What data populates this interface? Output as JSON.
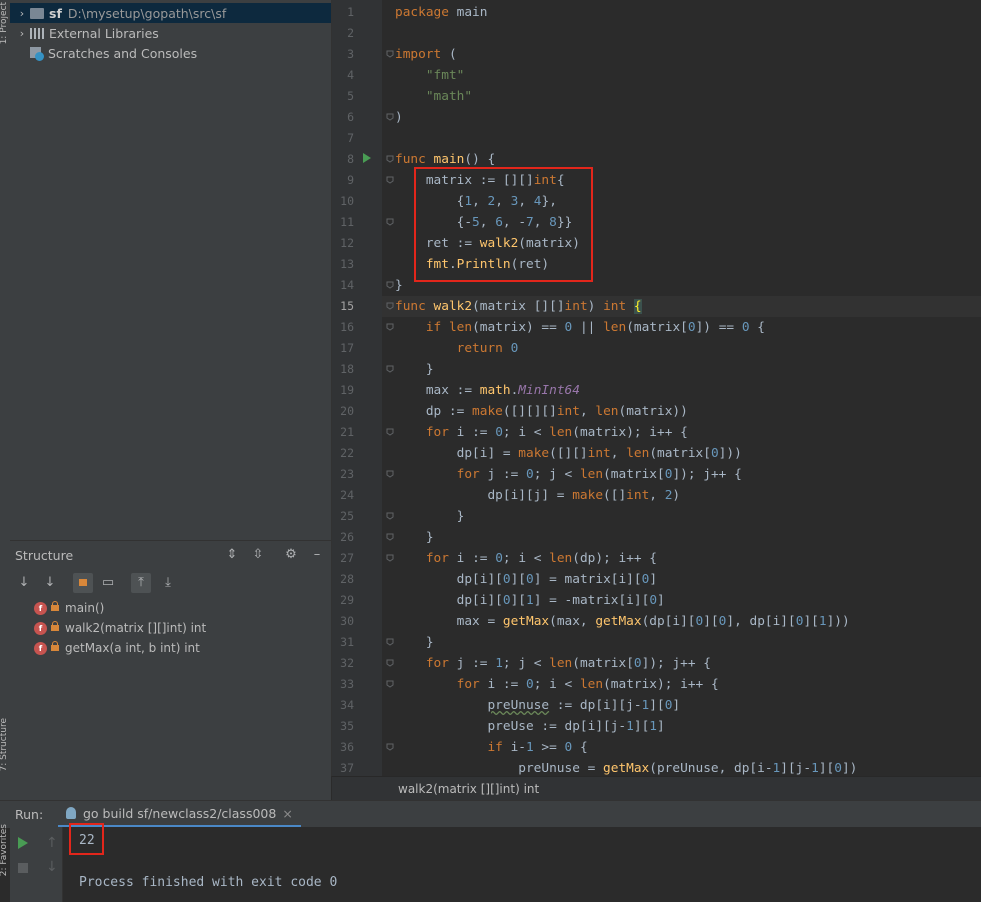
{
  "left_strip": {
    "top_label": "1: Project",
    "bottom_label": "7: Structure",
    "fav_label": "2: Favorites"
  },
  "project_tree": {
    "items": [
      {
        "name": "sf",
        "path": "D:\\mysetup\\gopath\\src\\sf"
      },
      {
        "name": "External Libraries"
      },
      {
        "name": "Scratches and Consoles"
      }
    ]
  },
  "structure": {
    "title": "Structure",
    "items": [
      {
        "badge": "f",
        "label": "main()"
      },
      {
        "badge": "f",
        "label": "walk2(matrix [][]int) int"
      },
      {
        "badge": "f",
        "label": "getMax(a int, b int) int"
      }
    ]
  },
  "editor": {
    "line_numbers": [
      "1",
      "2",
      "3",
      "4",
      "5",
      "6",
      "7",
      "8",
      "9",
      "10",
      "11",
      "12",
      "13",
      "14",
      "15",
      "16",
      "17",
      "18",
      "19",
      "20",
      "21",
      "22",
      "23",
      "24",
      "25",
      "26",
      "27",
      "28",
      "29",
      "30",
      "31",
      "32",
      "33",
      "34",
      "35",
      "36",
      "37"
    ],
    "lines": [
      "package main",
      "",
      "import (",
      "    \"fmt\"",
      "    \"math\"",
      ")",
      "",
      "func main() {",
      "    matrix := [][]int{",
      "        {1, 2, 3, 4},",
      "        {-5, 6, -7, 8}}",
      "    ret := walk2(matrix)",
      "    fmt.Println(ret)",
      "}",
      "func walk2(matrix [][]int) int {",
      "    if len(matrix) == 0 || len(matrix[0]) == 0 {",
      "        return 0",
      "    }",
      "    max := math.MinInt64",
      "    dp := make([][][]int, len(matrix))",
      "    for i := 0; i < len(matrix); i++ {",
      "        dp[i] = make([][]int, len(matrix[0]))",
      "        for j := 0; j < len(matrix[0]); j++ {",
      "            dp[i][j] = make([]int, 2)",
      "        }",
      "    }",
      "    for i := 0; i < len(dp); i++ {",
      "        dp[i][0][0] = matrix[i][0]",
      "        dp[i][0][1] = -matrix[i][0]",
      "        max = getMax(max, getMax(dp[i][0][0], dp[i][0][1]))",
      "    }",
      "    for j := 1; j < len(matrix[0]); j++ {",
      "        for i := 0; i < len(matrix); i++ {",
      "            preUnuse := dp[i][j-1][0]",
      "            preUse := dp[i][j-1][1]",
      "            if i-1 >= 0 {",
      "                preUnuse = getMax(preUnuse, dp[i-1][j-1][0])"
    ],
    "breadcrumb": "walk2(matrix [][]int) int"
  },
  "run": {
    "label": "Run:",
    "tab_title": "go build sf/newclass2/class008",
    "output_value": "22",
    "exit_message": "Process finished with exit code 0"
  },
  "colors": {
    "keyword": "#cc7832",
    "string": "#6a8759",
    "number": "#6897bb",
    "function": "#ffc66d",
    "constant": "#9876aa",
    "highlight_box": "#e2261b"
  }
}
